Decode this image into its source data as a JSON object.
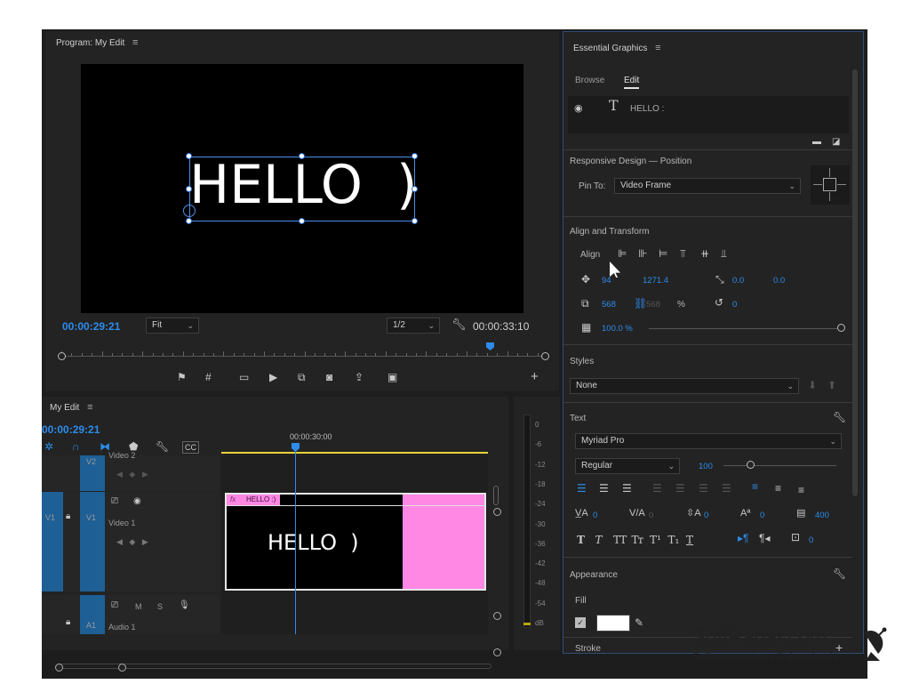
{
  "program": {
    "title": "Program: My Edit",
    "menu_glyph": "≡",
    "preview_text": "HELLO  )",
    "timecode_left": "00:00:29:21",
    "timecode_right": "00:00:33:10",
    "fit_select": "Fit",
    "quality_select": "1/2"
  },
  "timeline": {
    "title": "My Edit",
    "timecode": "00:00:29:21",
    "ruler_time": "00:00:30:00",
    "tracks": {
      "v2": "V2",
      "v2_name": "Video 2",
      "v1_left": "V1",
      "v1": "V1",
      "v1_name": "Video 1",
      "a1": "A1",
      "a1_name": "Audio 1",
      "m_label": "M",
      "s_label": "S"
    },
    "clip": {
      "fx_badge": "fx",
      "label": "HELLO :)",
      "text": "HELLO  )",
      "color": "#ff88e4"
    }
  },
  "meter": {
    "labels": [
      "0",
      "-6",
      "-12",
      "-18",
      "-24",
      "-30",
      "-36",
      "-42",
      "-48",
      "-54",
      "dB"
    ]
  },
  "essential_graphics": {
    "title": "Essential Graphics",
    "tabs": {
      "browse": "Browse",
      "edit": "Edit"
    },
    "layer_name": "HELLO :",
    "responsive_design_title": "Responsive Design — Position",
    "pin_to_label": "Pin To:",
    "pin_to_value": "Video Frame",
    "align_transform_title": "Align and Transform",
    "align_label": "Align",
    "position_x": "94",
    "position_y": "1271.4",
    "anchor_x": "0.0",
    "anchor_y": "0.0",
    "scale_w": "568",
    "scale_h": "568",
    "scale_unit": "%",
    "rotation": "0",
    "opacity": "100.0 %",
    "styles_title": "Styles",
    "styles_value": "None",
    "text_title": "Text",
    "font_family": "Myriad Pro",
    "font_style": "Regular",
    "font_size": "100",
    "tracking_values": {
      "kerning": "0",
      "tracking": "0",
      "leading": "0",
      "baseline": "0",
      "tsume": "400",
      "tab": "0"
    },
    "style_buttons": [
      "T",
      "T",
      "TT",
      "Tт",
      "T¹",
      "T₁",
      "T"
    ],
    "appearance_title": "Appearance",
    "fill_label": "Fill",
    "stroke_label": "Stroke",
    "fill_color": "#ffffff"
  },
  "watermark": {
    "brand": "SoftRadar.com",
    "tagline": "Software reviews & downloads"
  },
  "colors": {
    "accent": "#2d8ceb",
    "panel_bg": "#232323",
    "clip_pink": "#ff88e4",
    "playhead": "#2d8ceb"
  }
}
